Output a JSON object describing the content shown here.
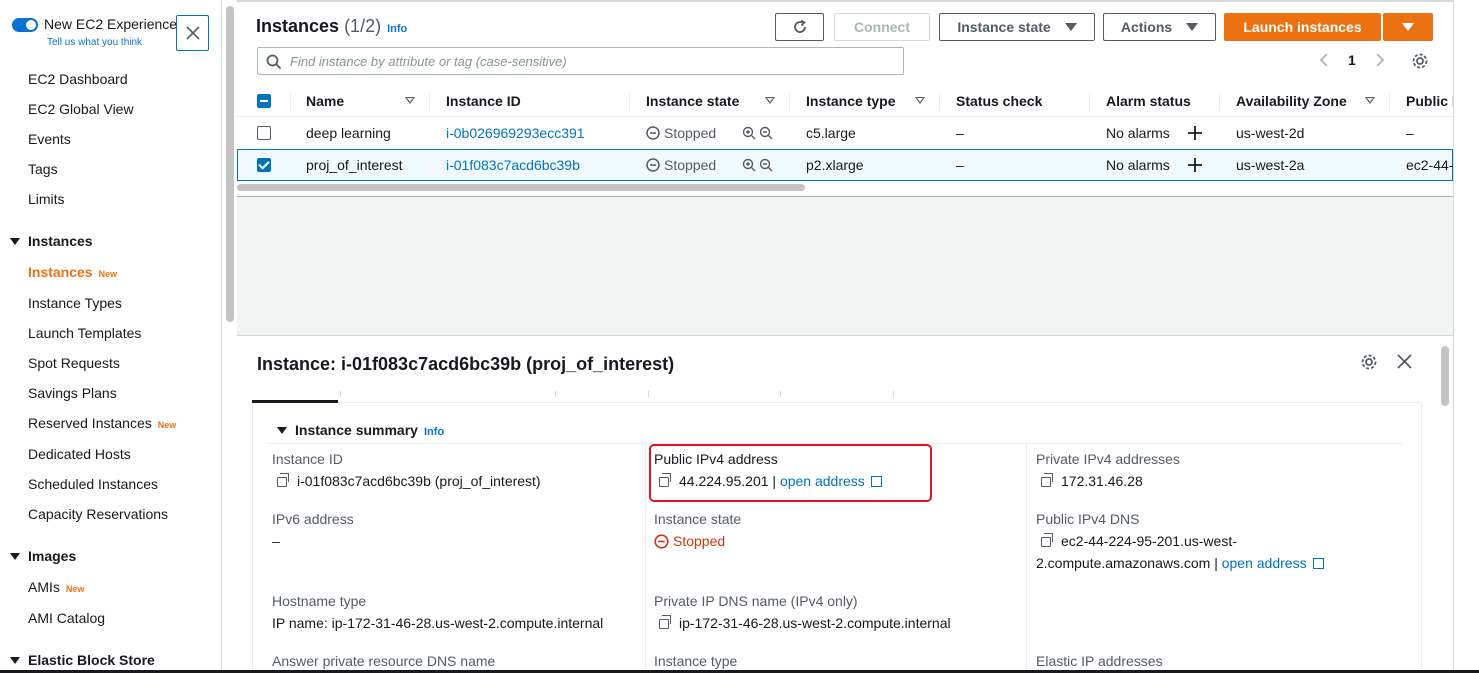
{
  "sidebar": {
    "toggle_label": "New EC2 Experience",
    "toggle_sub": "Tell us what you think",
    "items": [
      {
        "label": "EC2 Dashboard"
      },
      {
        "label": "EC2 Global View"
      },
      {
        "label": "Events"
      },
      {
        "label": "Tags"
      },
      {
        "label": "Limits"
      }
    ],
    "section_instances": "Instances",
    "instances_items": [
      {
        "label": "Instances",
        "badge": "New"
      },
      {
        "label": "Instance Types"
      },
      {
        "label": "Launch Templates"
      },
      {
        "label": "Spot Requests"
      },
      {
        "label": "Savings Plans"
      },
      {
        "label": "Reserved Instances",
        "badge": "New"
      },
      {
        "label": "Dedicated Hosts"
      },
      {
        "label": "Scheduled Instances"
      },
      {
        "label": "Capacity Reservations"
      }
    ],
    "section_images": "Images",
    "images_items": [
      {
        "label": "AMIs",
        "badge": "New"
      },
      {
        "label": "AMI Catalog"
      }
    ],
    "section_ebs": "Elastic Block Store"
  },
  "header": {
    "title": "Instances",
    "count": "(1/2)",
    "info": "Info",
    "connect": "Connect",
    "instance_state": "Instance state",
    "actions": "Actions",
    "launch": "Launch instances"
  },
  "search": {
    "placeholder": "Find instance by attribute or tag (case-sensitive)"
  },
  "pagination": {
    "page": "1"
  },
  "table": {
    "columns": [
      "Name",
      "Instance ID",
      "Instance state",
      "Instance type",
      "Status check",
      "Alarm status",
      "Availability Zone",
      "Public I"
    ],
    "rows": [
      {
        "name": "deep learning",
        "id": "i-0b026969293ecc391",
        "state": "Stopped",
        "type": "c5.large",
        "status": "–",
        "alarm": "No alarms",
        "az": "us-west-2d",
        "public": "–",
        "selected": false
      },
      {
        "name": "proj_of_interest",
        "id": "i-01f083c7acd6bc39b",
        "state": "Stopped",
        "type": "p2.xlarge",
        "status": "–",
        "alarm": "No alarms",
        "az": "us-west-2a",
        "public": "ec2-44-",
        "selected": true
      }
    ]
  },
  "detail": {
    "title": "Instance: i-01f083c7acd6bc39b (proj_of_interest)",
    "summary_title": "Instance summary",
    "summary_info": "Info",
    "fields": {
      "instance_id_label": "Instance ID",
      "instance_id_value": "i-01f083c7acd6bc39b (proj_of_interest)",
      "public_ipv4_label": "Public IPv4 address",
      "public_ipv4_value": "44.224.95.201",
      "public_ipv4_sep": " | ",
      "open_address": "open address",
      "private_ipv4_label": "Private IPv4 addresses",
      "private_ipv4_value": "172.31.46.28",
      "ipv6_label": "IPv6 address",
      "ipv6_value": "–",
      "instance_state_label": "Instance state",
      "instance_state_value": "Stopped",
      "public_dns_label": "Public IPv4 DNS",
      "public_dns_value_1": "ec2-44-224-95-201.us-west-",
      "public_dns_value_2": "2.compute.amazonaws.com",
      "public_dns_sep": " | ",
      "hostname_label": "Hostname type",
      "hostname_value": "IP name: ip-172-31-46-28.us-west-2.compute.internal",
      "private_dns_label": "Private IP DNS name (IPv4 only)",
      "private_dns_value": "ip-172-31-46-28.us-west-2.compute.internal",
      "answer_dns_label": "Answer private resource DNS name",
      "instance_type_label": "Instance type",
      "elastic_ip_label": "Elastic IP addresses"
    }
  },
  "colors": {
    "accent": "#ec7211",
    "link": "#0073bb",
    "stopped": "#d13212",
    "highlight": "#e0141e"
  }
}
